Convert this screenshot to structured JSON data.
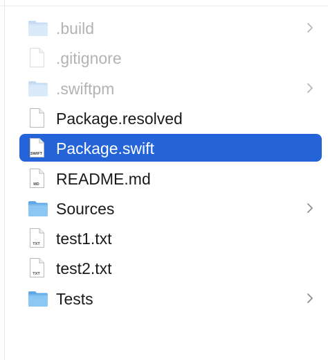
{
  "accent": "#2563d9",
  "rows": [
    {
      "name": "build",
      "label": ".build",
      "icon": "folder-icon",
      "dim": true,
      "chevron": true
    },
    {
      "name": "gitignore",
      "label": ".gitignore",
      "icon": "blank-file-icon",
      "dim": true,
      "chevron": false
    },
    {
      "name": "swiftpm",
      "label": ".swiftpm",
      "icon": "folder-icon",
      "dim": true,
      "chevron": true
    },
    {
      "name": "package-resolved",
      "label": "Package.resolved",
      "icon": "blank-file-icon",
      "dim": false,
      "chevron": false
    },
    {
      "name": "package-swift",
      "label": "Package.swift",
      "icon": "swift-file-icon",
      "badge": "SWIFT",
      "dim": false,
      "chevron": false,
      "selected": true
    },
    {
      "name": "readme-md",
      "label": "README.md",
      "icon": "md-file-icon",
      "badge": "MD",
      "dim": false,
      "chevron": false
    },
    {
      "name": "sources",
      "label": "Sources",
      "icon": "folder-icon",
      "dim": false,
      "chevron": true
    },
    {
      "name": "test1-txt",
      "label": "test1.txt",
      "icon": "txt-file-icon",
      "badge": "TXT",
      "dim": false,
      "chevron": false
    },
    {
      "name": "test2-txt",
      "label": "test2.txt",
      "icon": "txt-file-icon",
      "badge": "TXT",
      "dim": false,
      "chevron": false
    },
    {
      "name": "tests",
      "label": "Tests",
      "icon": "folder-icon",
      "dim": false,
      "chevron": true
    }
  ]
}
